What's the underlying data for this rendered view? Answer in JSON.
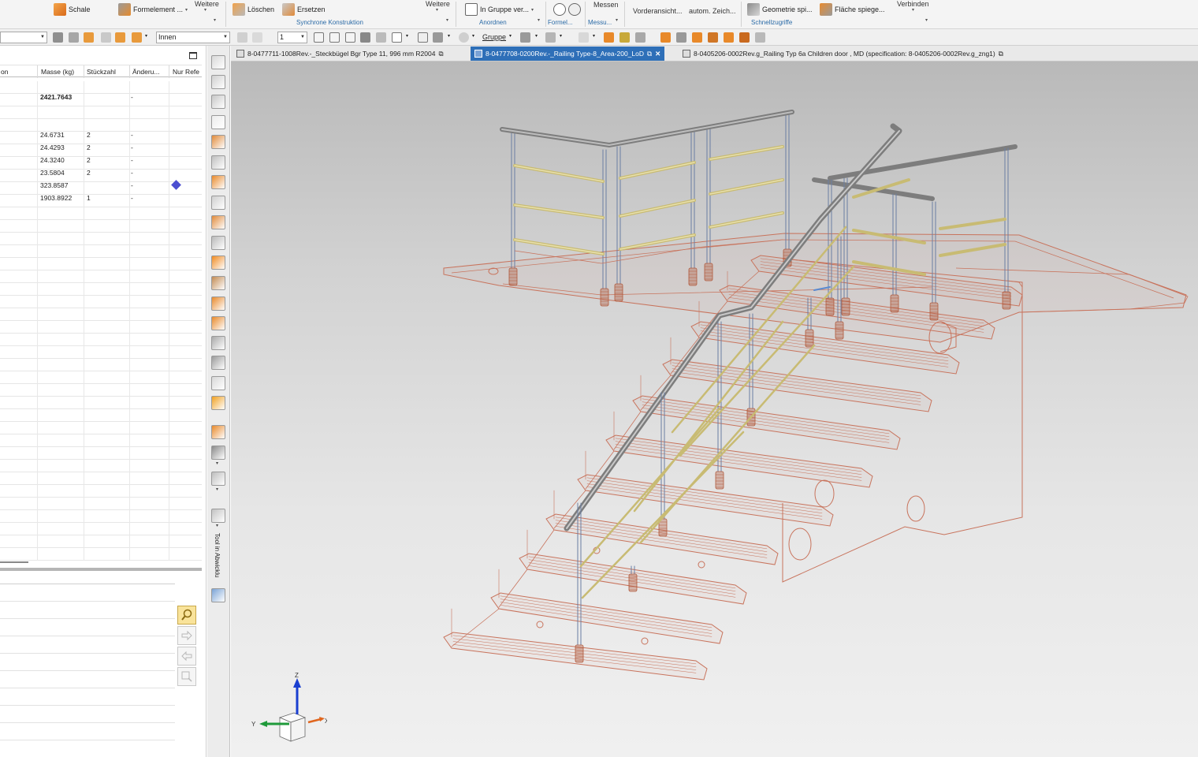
{
  "ribbon": {
    "commands": [
      {
        "label": "Schale",
        "icon": "shell-icon"
      },
      {
        "label": "Formelement ...",
        "icon": "feature-icon"
      },
      {
        "label": "Weitere",
        "icon": "more-icon"
      },
      {
        "label": "Löschen",
        "icon": "delete-icon"
      },
      {
        "label": "Ersetzen",
        "icon": "replace-icon"
      },
      {
        "label": "Weitere",
        "icon": "more-icon"
      },
      {
        "label": "In Gruppe ver...",
        "icon": "group-icon"
      },
      {
        "label": "Messen",
        "icon": "measure-icon"
      },
      {
        "label": "Vorderansicht...",
        "icon": "front-view-icon"
      },
      {
        "label": "autom. Zeich...",
        "icon": "auto-drawing-icon"
      },
      {
        "label": "Geometrie spi...",
        "icon": "mirror-geometry-icon"
      },
      {
        "label": "Fläche spiege...",
        "icon": "mirror-face-icon"
      },
      {
        "label": "Verbinden",
        "icon": "connect-icon"
      }
    ],
    "groups": [
      "Synchrone Konstruktion",
      "Anordnen",
      "Formel...",
      "Messu...",
      "Schnellzugriffe"
    ]
  },
  "toolbar2": {
    "filter_value": "",
    "scope_value": "Innen",
    "count_value": "1",
    "group_label": "Gruppe"
  },
  "table": {
    "columns": [
      "on",
      "Masse (kg)",
      "Stückzahl",
      "Änderu...",
      "Nur Refe"
    ],
    "rows": [
      {
        "mass": "2421.7643",
        "qty": "",
        "change": "-",
        "ref": "",
        "bold": true
      },
      {
        "mass": "",
        "qty": "",
        "change": "",
        "ref": ""
      },
      {
        "mass": "",
        "qty": "",
        "change": "",
        "ref": ""
      },
      {
        "mass": "24.6731",
        "qty": "2",
        "change": "-",
        "ref": ""
      },
      {
        "mass": "24.4293",
        "qty": "2",
        "change": "-",
        "ref": ""
      },
      {
        "mass": "24.3240",
        "qty": "2",
        "change": "-",
        "ref": ""
      },
      {
        "mass": "23.5804",
        "qty": "2",
        "change": "-",
        "ref": ""
      },
      {
        "mass": "323.8587",
        "qty": "",
        "change": "-",
        "ref": "cube-icon"
      },
      {
        "mass": "1903.8922",
        "qty": "1",
        "change": "-",
        "ref": ""
      }
    ]
  },
  "vertical_toolbar_text": "Tool in Abwicklu",
  "tabs": [
    {
      "label": "8-0477711-1008Rev.-_Steckbügel Bgr Type 11, 996 mm R2004",
      "active": false
    },
    {
      "label": "8-0477708-0200Rev.-_Railing Type-8_Area-200_LoD",
      "active": true
    },
    {
      "label": "8-0405206-0002Rev.g_Railing Typ 6a Children door , MD (specification: 8-0405206-0002Rev.g_zng1)",
      "active": false
    }
  ],
  "triad": {
    "x": "X",
    "y": "Y",
    "z": "Z"
  },
  "colors": {
    "accent": "#2e6fb8",
    "group_label": "#2a6aa6",
    "stair_lines": "#c8735c",
    "rail": "#7d7d7d",
    "infill": "#c8bb73",
    "post": "#6a7ea3",
    "foot": "#b15a3c"
  }
}
